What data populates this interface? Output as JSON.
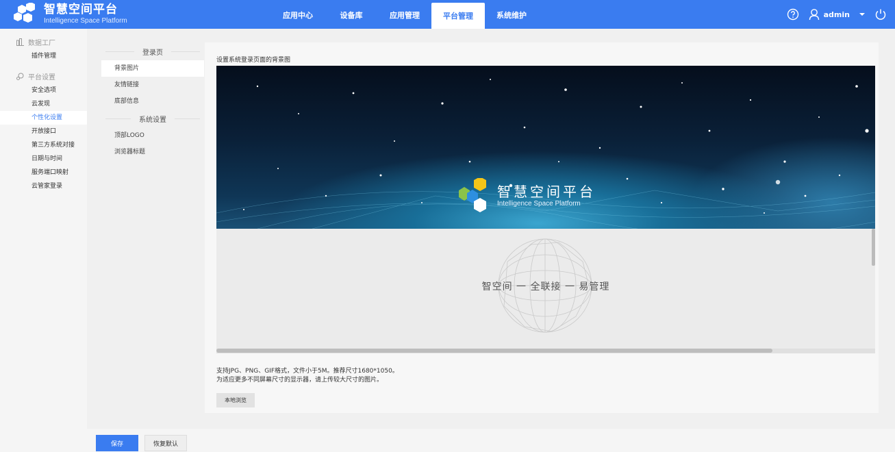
{
  "app": {
    "title": "智慧空间平台",
    "subtitle": "Intelligence Space Platform"
  },
  "nav": {
    "items": [
      {
        "label": "应用中心"
      },
      {
        "label": "设备库"
      },
      {
        "label": "应用管理"
      },
      {
        "label": "平台管理",
        "active": true
      },
      {
        "label": "系统维护"
      }
    ]
  },
  "header": {
    "user": "admin",
    "icons": [
      "help-icon",
      "user-icon",
      "caret-down-icon",
      "power-icon"
    ]
  },
  "sidebar": {
    "groups": [
      {
        "label": "数据工厂",
        "icon": "data-factory-icon",
        "items": [
          "插件管理"
        ]
      },
      {
        "label": "平台设置",
        "icon": "settings-icon",
        "items": [
          "安全选项",
          "云发现",
          "个性化设置",
          "开放接口",
          "第三方系统对接",
          "日期与时间",
          "服务端口映射",
          "云管家登录"
        ],
        "active": "个性化设置"
      }
    ]
  },
  "submenu": {
    "section1": "登录页",
    "items1": [
      "背景图片",
      "友情链接",
      "底部信息"
    ],
    "section2": "系统设置",
    "items2": [
      "顶部LOGO",
      "浏览器标题"
    ],
    "active": "背景图片"
  },
  "main": {
    "title": "设置系统登录页面的背景图",
    "banner_title": "智慧空间平台",
    "banner_subtitle": "Intelligence Space Platform",
    "slogan": "智空间 一 全联接 一 易管理",
    "hint_line1": "支持JPG、PNG、GIF格式，文件小于5M。推荐尺寸1680*1050。",
    "hint_line2": "为适应更多不同屏幕尺寸的显示器，请上传较大尺寸的图片。",
    "browse_label": "本地浏览"
  },
  "footer": {
    "save_label": "保存",
    "reset_label": "恢复默认"
  },
  "colors": {
    "primary": "#3a7cf0",
    "logo_yellow": "#f5c518",
    "logo_green": "#8bc34a",
    "logo_blue": "#2d8fe0"
  }
}
